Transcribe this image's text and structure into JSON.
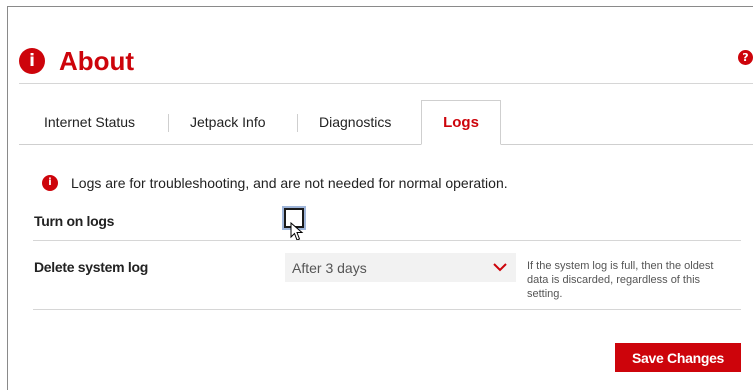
{
  "header": {
    "icon_glyph": "i",
    "title": "About",
    "help_glyph": "?"
  },
  "tabs": [
    {
      "label": "Internet Status",
      "active": false
    },
    {
      "label": "Jetpack Info",
      "active": false
    },
    {
      "label": "Diagnostics",
      "active": false
    },
    {
      "label": "Logs",
      "active": true
    }
  ],
  "info": {
    "icon_glyph": "i",
    "text": "Logs are for troubleshooting, and are not needed for normal operation."
  },
  "settings": {
    "turn_on_logs": {
      "label": "Turn on logs",
      "checked": false
    },
    "delete_system_log": {
      "label": "Delete system log",
      "selected_value": "After 3 days",
      "hint": "If the system log is full, then the oldest data is discarded, regardless of this setting."
    }
  },
  "actions": {
    "save_label": "Save Changes"
  },
  "colors": {
    "brand_red": "#cd040b",
    "select_bg": "#f2f2f2",
    "focus_outline": "#9fb5d9"
  },
  "icons": [
    "info-icon",
    "help-icon",
    "chevron-down-icon",
    "mouse-cursor-icon"
  ]
}
